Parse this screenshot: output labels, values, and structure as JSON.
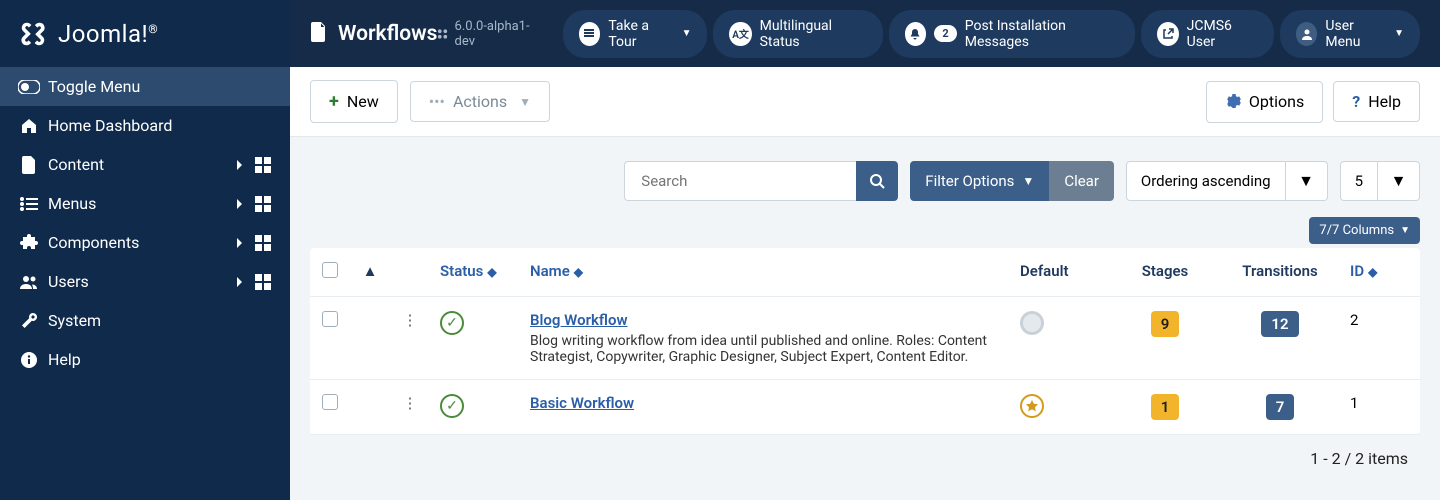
{
  "brand": "Joomla!",
  "sidebar": {
    "toggle": "Toggle Menu",
    "items": [
      {
        "label": "Home Dashboard",
        "icon": "home",
        "hasSub": false,
        "hasDash": false
      },
      {
        "label": "Content",
        "icon": "file",
        "hasSub": true,
        "hasDash": true
      },
      {
        "label": "Menus",
        "icon": "list",
        "hasSub": true,
        "hasDash": true
      },
      {
        "label": "Components",
        "icon": "puzzle",
        "hasSub": true,
        "hasDash": true
      },
      {
        "label": "Users",
        "icon": "users",
        "hasSub": true,
        "hasDash": true
      },
      {
        "label": "System",
        "icon": "wrench",
        "hasSub": false,
        "hasDash": false
      },
      {
        "label": "Help",
        "icon": "info",
        "hasSub": false,
        "hasDash": false
      }
    ]
  },
  "header": {
    "title": "Workflows",
    "version": "6.0.0-alpha1-dev",
    "pills": {
      "tour": "Take a Tour",
      "multilingual": "Multilingual Status",
      "post_count": "2",
      "post": "Post Installation Messages",
      "user": "JCMS6 User",
      "usermenu": "User Menu"
    }
  },
  "toolbar": {
    "new": "New",
    "actions": "Actions",
    "options": "Options",
    "help": "Help"
  },
  "filters": {
    "search_placeholder": "Search",
    "filter_options": "Filter Options",
    "clear": "Clear",
    "sort": "Ordering ascending",
    "pagesize": "5",
    "columns": "7/7 Columns"
  },
  "table": {
    "headers": {
      "status": "Status",
      "name": "Name",
      "default": "Default",
      "stages": "Stages",
      "transitions": "Transitions",
      "id": "ID"
    },
    "rows": [
      {
        "name": "Blog Workflow",
        "description": "Blog writing workflow from idea until published and online. Roles: Content Strategist, Copywriter, Graphic Designer, Subject Expert, Content Editor.",
        "default": false,
        "stages": "9",
        "transitions": "12",
        "id": "2"
      },
      {
        "name": "Basic Workflow",
        "description": "",
        "default": true,
        "stages": "1",
        "transitions": "7",
        "id": "1"
      }
    ]
  },
  "pager": "1 - 2 / 2 items"
}
